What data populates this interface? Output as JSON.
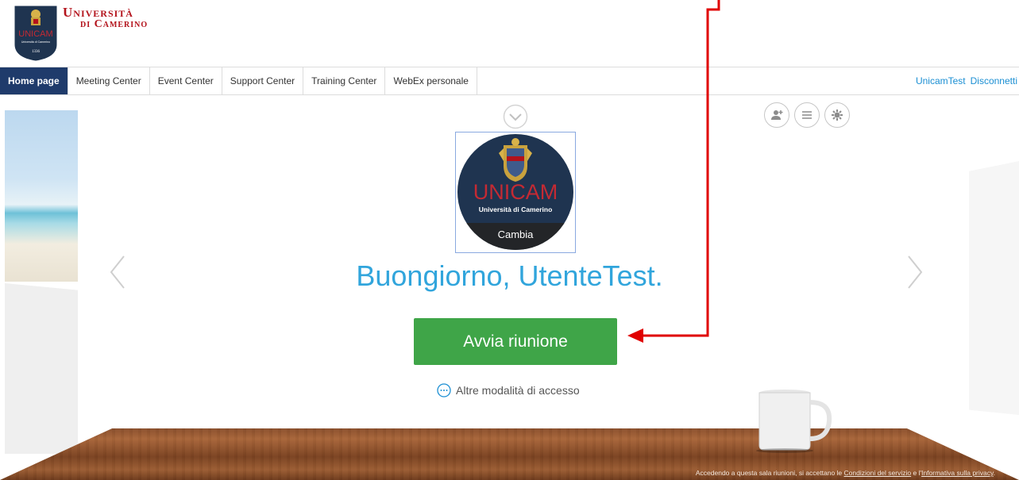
{
  "header": {
    "logo_line1": "Università",
    "logo_line2": "di Camerino",
    "shield_text": "UNICAM",
    "shield_subtext": "Università di Camerino",
    "shield_year": "1336"
  },
  "nav": {
    "tabs": [
      {
        "label": "Home page",
        "active": true
      },
      {
        "label": "Meeting Center"
      },
      {
        "label": "Event Center"
      },
      {
        "label": "Support Center"
      },
      {
        "label": "Training Center"
      },
      {
        "label": "WebEx personale"
      }
    ],
    "user_link": "UnicamTest",
    "logout_link": "Disconnetti"
  },
  "main": {
    "avatar": {
      "logo_text": "UNICAM",
      "logo_subtext": "Università di Camerino",
      "change_label": "Cambia"
    },
    "greeting": "Buongiorno, UtenteTest.",
    "start_button": "Avvia riunione",
    "other_access": "Altre modalità di accesso",
    "action_icons": [
      "add-contact-icon",
      "menu-icon",
      "settings-icon"
    ]
  },
  "footer": {
    "prefix": "Accedendo a questa sala riunioni, si accettano le ",
    "terms_link": "Condizioni del servizio",
    "conjunction": " e l'",
    "privacy_link": "Informativa sulla privacy",
    "suffix": "."
  },
  "colors": {
    "nav_active": "#1f3b6b",
    "link": "#1b8fd3",
    "greeting": "#31a5dc",
    "start_button": "#3fa548",
    "logo_red": "#b3121b",
    "annotation": "#e00000"
  }
}
